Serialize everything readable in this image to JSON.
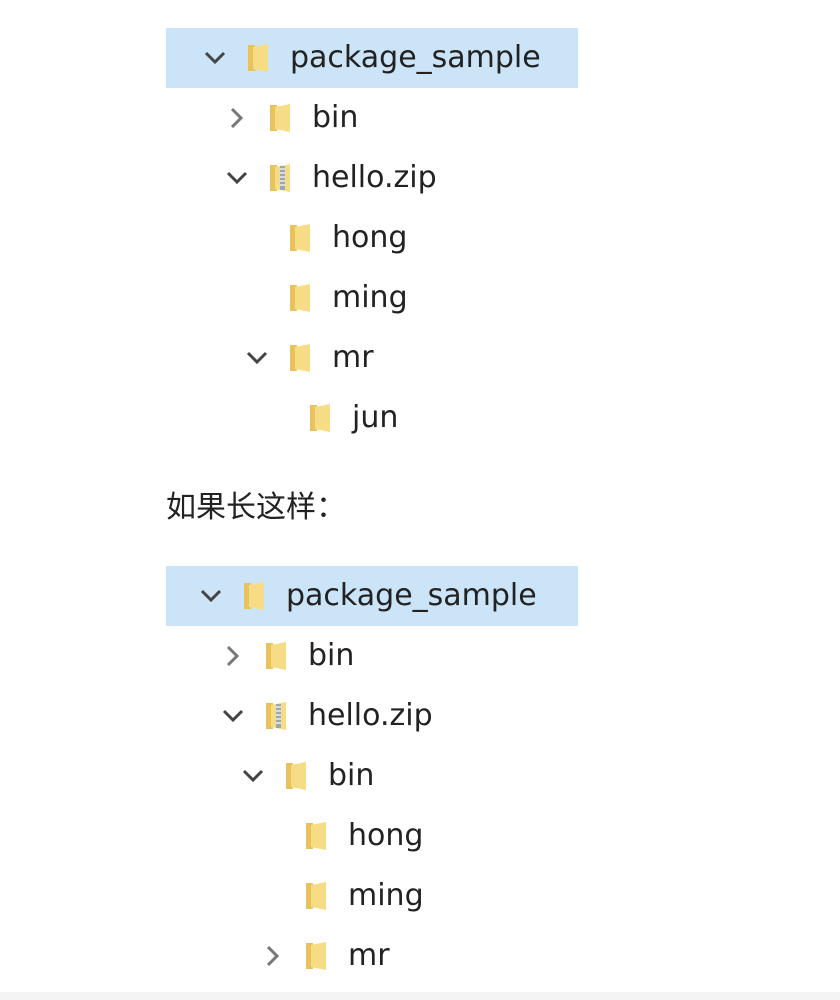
{
  "tree_a": {
    "items": [
      {
        "label": "package_sample",
        "icon": "folder-icon",
        "expander": "expanded",
        "selected": true
      },
      {
        "label": "bin",
        "icon": "folder-icon",
        "expander": "collapsed",
        "selected": false
      },
      {
        "label": "hello.zip",
        "icon": "zip-folder-icon",
        "expander": "expanded",
        "selected": false
      },
      {
        "label": "hong",
        "icon": "folder-icon",
        "expander": "none",
        "selected": false
      },
      {
        "label": "ming",
        "icon": "folder-icon",
        "expander": "none",
        "selected": false
      },
      {
        "label": "mr",
        "icon": "folder-icon",
        "expander": "expanded",
        "selected": false
      },
      {
        "label": "jun",
        "icon": "folder-icon",
        "expander": "none",
        "selected": false
      }
    ]
  },
  "caption": "如果长这样：",
  "tree_b": {
    "items": [
      {
        "label": "package_sample",
        "icon": "folder-icon",
        "expander": "expanded",
        "selected": true
      },
      {
        "label": "bin",
        "icon": "folder-icon",
        "expander": "collapsed",
        "selected": false
      },
      {
        "label": "hello.zip",
        "icon": "zip-folder-icon",
        "expander": "expanded",
        "selected": false
      },
      {
        "label": "bin",
        "icon": "folder-icon",
        "expander": "expanded",
        "selected": false
      },
      {
        "label": "hong",
        "icon": "folder-icon",
        "expander": "none",
        "selected": false
      },
      {
        "label": "ming",
        "icon": "folder-icon",
        "expander": "none",
        "selected": false
      },
      {
        "label": "mr",
        "icon": "folder-icon",
        "expander": "collapsed",
        "selected": false
      }
    ]
  },
  "colors": {
    "selection": "#cce4f7",
    "folder": "#f5d77a",
    "chevron": "#444444"
  }
}
